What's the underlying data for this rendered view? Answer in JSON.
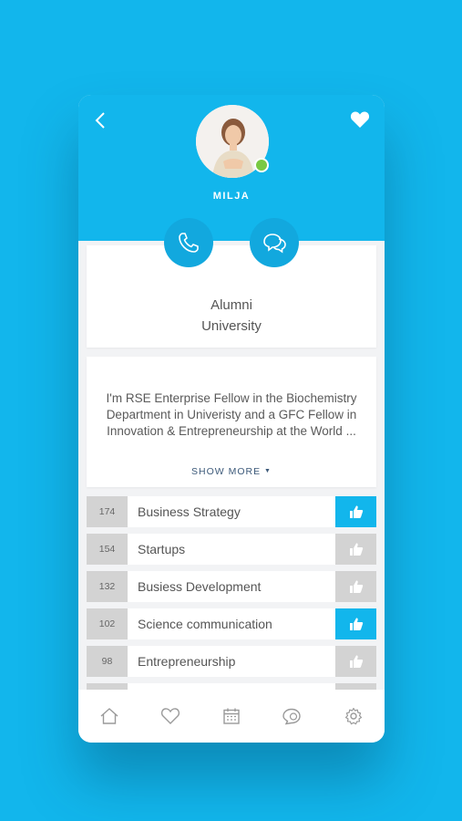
{
  "profile": {
    "name": "MILJA",
    "status": "online"
  },
  "info": {
    "line1": "Alumni",
    "line2": "University"
  },
  "bio": {
    "text": "I'm RSE Enterprise Fellow in the Biochemistry Department in Univeristy and a GFC Fellow in Innovation & Entrepreneurship at the World ...",
    "show_more_label": "SHOW MORE"
  },
  "skills": [
    {
      "count": "174",
      "label": "Business Strategy",
      "liked": true
    },
    {
      "count": "154",
      "label": "Startups",
      "liked": false
    },
    {
      "count": "132",
      "label": "Busiess Development",
      "liked": false
    },
    {
      "count": "102",
      "label": "Science communication",
      "liked": true
    },
    {
      "count": "98",
      "label": "Entrepreneurship",
      "liked": false
    }
  ],
  "tabbar": [
    "home-icon",
    "heart-icon",
    "calendar-icon",
    "chat-icon",
    "gear-icon"
  ],
  "colors": {
    "accent": "#12b6ec",
    "online": "#7ac943",
    "inactive": "#d3d3d3"
  }
}
